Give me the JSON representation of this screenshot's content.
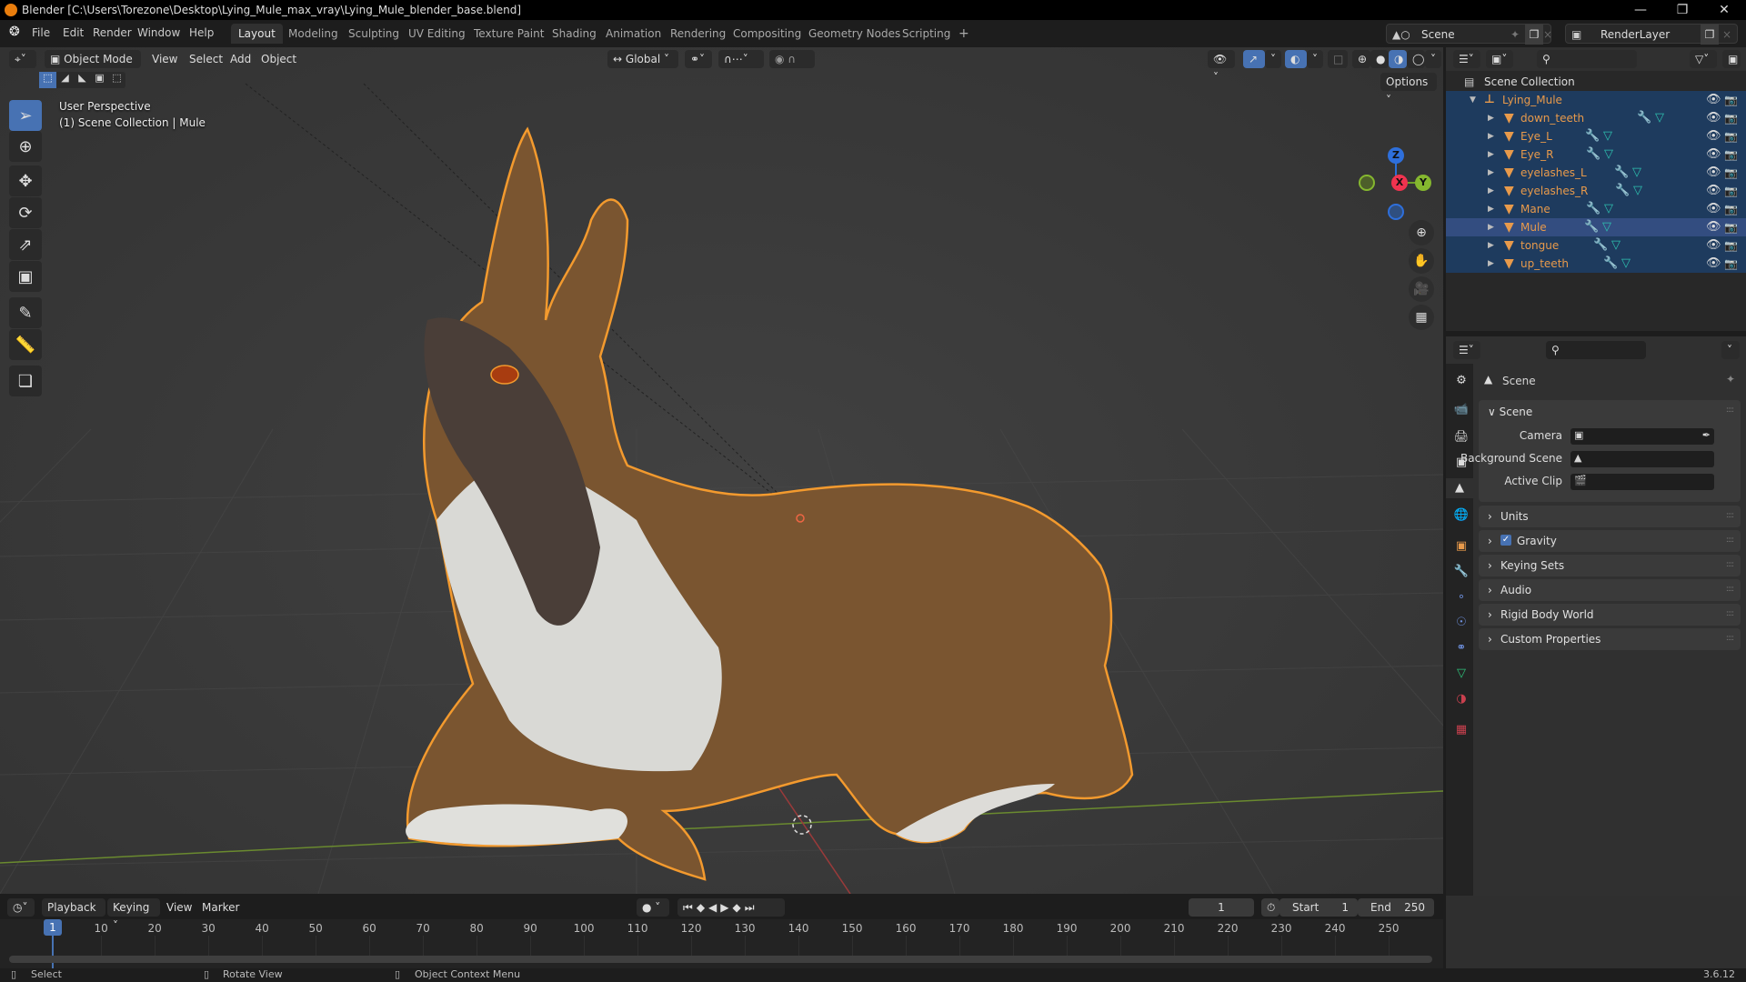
{
  "window": {
    "title": "Blender [C:\\Users\\Torezone\\Desktop\\Lying_Mule_max_vray\\Lying_Mule_blender_base.blend]",
    "controls": [
      "minimize",
      "maximize",
      "close"
    ]
  },
  "menu": [
    "File",
    "Edit",
    "Render",
    "Window",
    "Help"
  ],
  "workspaces": {
    "active": "Layout",
    "tabs": [
      "Layout",
      "Modeling",
      "Sculpting",
      "UV Editing",
      "Texture Paint",
      "Shading",
      "Animation",
      "Rendering",
      "Compositing",
      "Geometry Nodes",
      "Scripting"
    ],
    "add": "+"
  },
  "scene_selector": {
    "value": "Scene"
  },
  "viewlayer_selector": {
    "value": "RenderLayer"
  },
  "viewport": {
    "mode": "Object Mode",
    "menus": [
      "View",
      "Select",
      "Add",
      "Object"
    ],
    "transform_orientation": "Global",
    "options_label": "Options",
    "overlay_line1": "User Perspective",
    "overlay_line2": "(1) Scene Collection | Mule",
    "gizmo": {
      "x": "X",
      "y": "Y",
      "z": "Z"
    },
    "tools": [
      "select-box",
      "cursor",
      "move",
      "rotate",
      "scale",
      "transform",
      "annotate",
      "measure",
      "add-cube"
    ],
    "active_tool": "select-box",
    "shading_mode": "material-preview"
  },
  "outliner": {
    "root": "Scene Collection",
    "collection": "Lying_Mule",
    "items": [
      {
        "name": "down_teeth",
        "selected": true,
        "active": false
      },
      {
        "name": "Eye_L",
        "selected": true,
        "active": false
      },
      {
        "name": "Eye_R",
        "selected": true,
        "active": false
      },
      {
        "name": "eyelashes_L",
        "selected": true,
        "active": false
      },
      {
        "name": "eyelashes_R",
        "selected": true,
        "active": false
      },
      {
        "name": "Mane",
        "selected": true,
        "active": false
      },
      {
        "name": "Mule",
        "selected": true,
        "active": true
      },
      {
        "name": "tongue",
        "selected": true,
        "active": false
      },
      {
        "name": "up_teeth",
        "selected": true,
        "active": false
      }
    ]
  },
  "properties": {
    "context": "Scene",
    "active_tab": "scene",
    "tabs": [
      "tool",
      "render",
      "output",
      "view-layer",
      "scene",
      "world",
      "object",
      "modifiers",
      "particles",
      "physics",
      "constraints",
      "data",
      "material",
      "texture"
    ],
    "scene_panel": {
      "title": "Scene",
      "fields": [
        {
          "label": "Camera",
          "value": ""
        },
        {
          "label": "Background Scene",
          "value": ""
        },
        {
          "label": "Active Clip",
          "value": ""
        }
      ]
    },
    "panels": [
      {
        "title": "Units",
        "checkbox": null
      },
      {
        "title": "Gravity",
        "checkbox": true
      },
      {
        "title": "Keying Sets",
        "checkbox": null
      },
      {
        "title": "Audio",
        "checkbox": null
      },
      {
        "title": "Rigid Body World",
        "checkbox": null
      },
      {
        "title": "Custom Properties",
        "checkbox": null
      }
    ]
  },
  "timeline": {
    "menus": [
      "Playback",
      "Keying",
      "View",
      "Marker"
    ],
    "current_frame": "1",
    "start_label": "Start",
    "start": "1",
    "end_label": "End",
    "end": "250",
    "ticks": [
      "10",
      "20",
      "30",
      "40",
      "50",
      "60",
      "70",
      "80",
      "90",
      "100",
      "110",
      "120",
      "130",
      "140",
      "150",
      "160",
      "170",
      "180",
      "190",
      "200",
      "210",
      "220",
      "230",
      "240",
      "250"
    ]
  },
  "statusbar": {
    "items": [
      "Select",
      "Rotate View",
      "Object Context Menu"
    ],
    "version": "3.6.12"
  }
}
